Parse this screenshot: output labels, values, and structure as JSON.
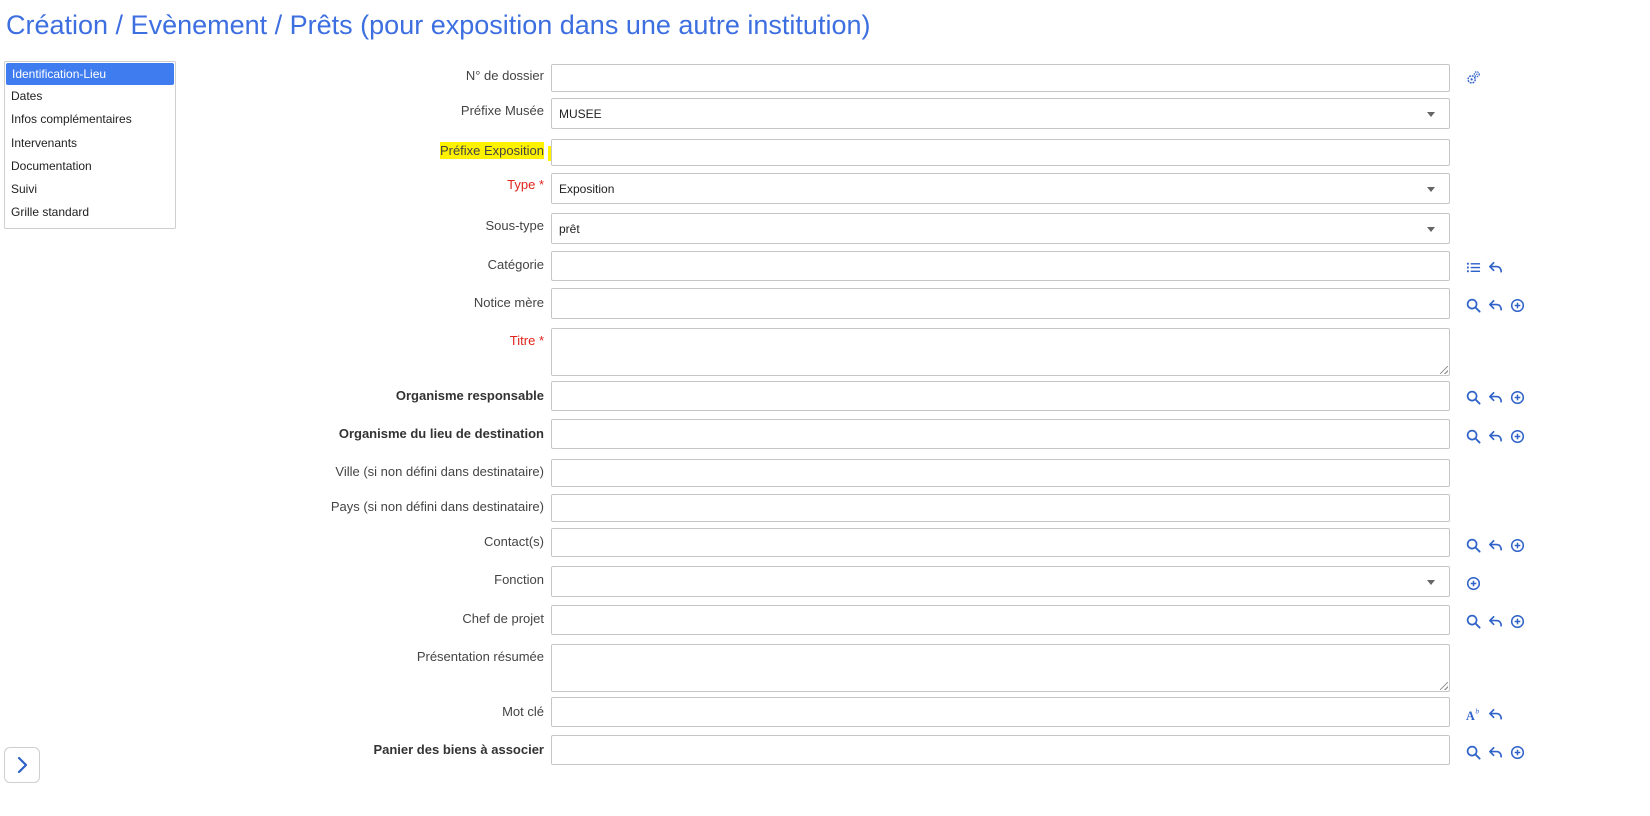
{
  "title": "Création / Evènement / Prêts (pour exposition dans une autre institution)",
  "sidebar": {
    "items": [
      {
        "label": "Identification-Lieu",
        "active": true
      },
      {
        "label": "Dates"
      },
      {
        "label": "Infos complémentaires"
      },
      {
        "label": "Intervenants"
      },
      {
        "label": "Documentation"
      },
      {
        "label": "Suivi"
      },
      {
        "label": "Grille standard"
      }
    ]
  },
  "form": {
    "no_dossier": {
      "label": "N° de dossier",
      "value": ""
    },
    "prefixe_musee": {
      "label": "Préfixe Musée",
      "value": "MUSEE"
    },
    "prefixe_exposition": {
      "label": "Préfixe Exposition",
      "value": "",
      "highlight_color": "#fff200"
    },
    "type": {
      "label": "Type",
      "required_mark": "*",
      "value": "Exposition"
    },
    "sous_type": {
      "label": "Sous-type",
      "value": "prêt"
    },
    "categorie": {
      "label": "Catégorie",
      "value": ""
    },
    "notice_mere": {
      "label": "Notice mère",
      "value": ""
    },
    "titre": {
      "label": "Titre",
      "required_mark": "*",
      "value": ""
    },
    "organisme_responsable": {
      "label": "Organisme responsable",
      "value": ""
    },
    "organisme_destination": {
      "label": "Organisme du lieu de destination",
      "value": ""
    },
    "ville": {
      "label": "Ville (si non défini dans destinataire)",
      "value": ""
    },
    "pays": {
      "label": "Pays (si non défini dans destinataire)",
      "value": ""
    },
    "contacts": {
      "label": "Contact(s)",
      "value": ""
    },
    "fonction": {
      "label": "Fonction",
      "value": ""
    },
    "chef_projet": {
      "label": "Chef de projet",
      "value": ""
    },
    "presentation": {
      "label": "Présentation résumée",
      "value": ""
    },
    "mot_cle": {
      "label": "Mot clé",
      "value": ""
    },
    "panier": {
      "label": "Panier des biens à associer",
      "value": ""
    }
  },
  "colors": {
    "accent": "#3d6fe0",
    "required": "#e0241b",
    "sidebar_active_bg": "#3f7cf0"
  },
  "icons": {
    "generate": "gears-icon",
    "list": "list-icon",
    "undo": "undo-arrow-icon",
    "search": "search-icon",
    "add": "add-circle-icon",
    "font": "font-style-icon",
    "expand": "chevron-right-icon"
  }
}
